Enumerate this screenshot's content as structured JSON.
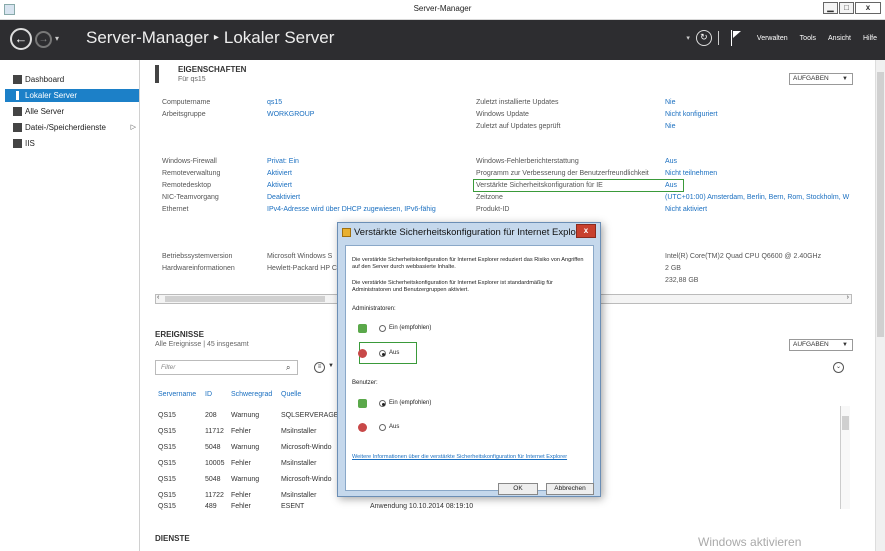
{
  "window": {
    "title": "Server-Manager",
    "minimize": "▁",
    "maximize": "□",
    "close": "x"
  },
  "header": {
    "back": "←",
    "forward": "→",
    "dropdown": "▾",
    "breadcrumb_root": "Server-Manager",
    "breadcrumb_sep": "▸",
    "breadcrumb_page": "Lokaler Server",
    "refresh_dd": "▾",
    "refresh": "↻",
    "menus": [
      "Verwalten",
      "Tools",
      "Ansicht",
      "Hilfe"
    ]
  },
  "sidebar": {
    "items": [
      {
        "label": "Dashboard"
      },
      {
        "label": "Lokaler Server"
      },
      {
        "label": "Alle Server"
      },
      {
        "label": "Datei-/Speicherdienste"
      },
      {
        "label": "IIS"
      }
    ],
    "arrow": "▷"
  },
  "properties": {
    "title": "EIGENSCHAFTEN",
    "subtitle": "Für qs15",
    "tasks": "AUFGABEN",
    "left": [
      {
        "label": "Computername",
        "value": "qs15"
      },
      {
        "label": "Arbeitsgruppe",
        "value": "WORKGROUP"
      },
      {
        "label": "Windows-Firewall",
        "value": "Privat: Ein"
      },
      {
        "label": "Remoteverwaltung",
        "value": "Aktiviert"
      },
      {
        "label": "Remotedesktop",
        "value": "Aktiviert"
      },
      {
        "label": "NIC-Teamvorgang",
        "value": "Deaktiviert"
      },
      {
        "label": "Ethernet",
        "value": "IPv4-Adresse wird über DHCP zugewiesen, IPv6-fähig"
      },
      {
        "label": "Betriebssystemversion",
        "value": "Microsoft Windows S"
      },
      {
        "label": "Hardwareinformationen",
        "value": "Hewlett-Packard HP C"
      }
    ],
    "right": [
      {
        "label": "Zuletzt installierte Updates",
        "value": "Nie"
      },
      {
        "label": "Windows Update",
        "value": "Nicht konfiguriert"
      },
      {
        "label": "Zuletzt auf Updates geprüft",
        "value": "Nie"
      },
      {
        "label": "Windows-Fehlerberichterstattung",
        "value": "Aus"
      },
      {
        "label": "Programm zur Verbesserung der Benutzerfreundlichkeit",
        "value": "Nicht teilnehmen"
      },
      {
        "label": "Verstärkte Sicherheitskonfiguration für IE",
        "value": "Aus"
      },
      {
        "label": "Zeitzone",
        "value": "(UTC+01:00) Amsterdam, Berlin, Bern, Rom, Stockholm, W"
      },
      {
        "label": "Produkt-ID",
        "value": "Nicht aktiviert"
      }
    ],
    "hw": [
      "Intel(R) Core(TM)2 Quad CPU    Q6600  @ 2.40GHz",
      "2 GB",
      "232,88 GB"
    ]
  },
  "events": {
    "title": "EREIGNISSE",
    "subtitle": "Alle Ereignisse | 45 insgesamt",
    "tasks": "AUFGABEN",
    "filter_placeholder": "Filter",
    "columns": [
      "Servername",
      "ID",
      "Schweregrad",
      "Quelle"
    ],
    "rows": [
      [
        "QS15",
        "208",
        "Warnung",
        "SQLSERVERAGENT"
      ],
      [
        "QS15",
        "11712",
        "Fehler",
        "MsiInstaller"
      ],
      [
        "QS15",
        "5048",
        "Warnung",
        "Microsoft-Windo"
      ],
      [
        "QS15",
        "10005",
        "Fehler",
        "MsiInstaller"
      ],
      [
        "QS15",
        "5048",
        "Warnung",
        "Microsoft-Windo"
      ],
      [
        "QS15",
        "11722",
        "Fehler",
        "MsiInstaller"
      ],
      [
        "QS15",
        "489",
        "Fehler",
        "ESENT"
      ]
    ],
    "last_row_extra": "Anwendung    10.10.2014 08:19:10"
  },
  "services": {
    "title": "DIENSTE"
  },
  "watermark": "Windows aktivieren",
  "dialog": {
    "title": "Verstärkte Sicherheitskonfiguration für Internet Explo...",
    "close": "x",
    "text1": "Die verstärkte Sicherheitskonfiguration für Internet Explorer reduziert das Risiko von Angriffen auf den Server durch webbasierte Inhalte.",
    "text2": "Die verstärkte Sicherheitskonfiguration für Internet Explorer ist standardmäßig für Administratoren und Benutzergruppen aktiviert.",
    "admins_label": "Administratoren:",
    "users_label": "Benutzer:",
    "on_recommended": "Ein (empfohlen)",
    "off": "Aus",
    "link": "Weitere Informationen über die verstärkte Sicherheitskonfiguration für Internet Explorer",
    "ok": "OK",
    "cancel": "Abbrechen",
    "admins_selected": "Aus",
    "users_selected": "Ein (empfohlen)"
  },
  "colors": {
    "header_bg": "#2d2d30",
    "selection": "#1c80c8",
    "link": "#1a6fc0",
    "highlight": "#3a9a3a"
  }
}
